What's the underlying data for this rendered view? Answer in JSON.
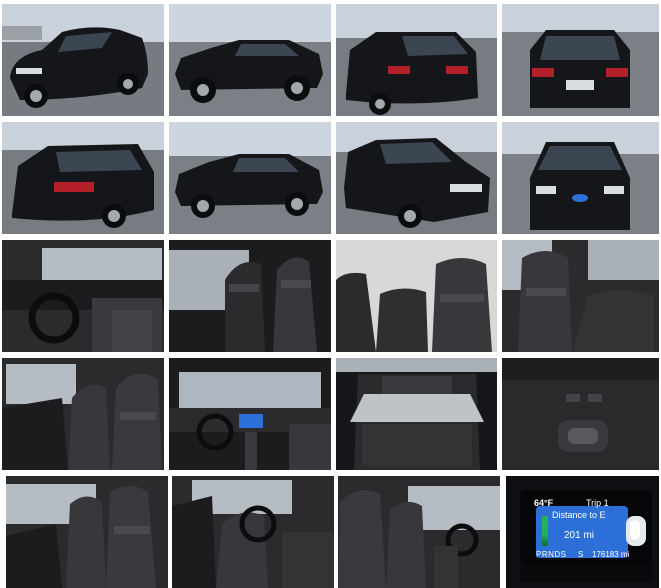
{
  "gallery": {
    "photos": [
      {
        "subject": "exterior-front-left"
      },
      {
        "subject": "exterior-left-side"
      },
      {
        "subject": "exterior-rear-left"
      },
      {
        "subject": "exterior-rear"
      },
      {
        "subject": "exterior-rear-left-closeup"
      },
      {
        "subject": "exterior-side-profile"
      },
      {
        "subject": "exterior-front-right"
      },
      {
        "subject": "exterior-front"
      },
      {
        "subject": "interior-driver-dashboard"
      },
      {
        "subject": "interior-front-seats"
      },
      {
        "subject": "interior-rear-seats"
      },
      {
        "subject": "interior-rear-seats-angle"
      },
      {
        "subject": "interior-rear-seat-door"
      },
      {
        "subject": "interior-dashboard-view"
      },
      {
        "subject": "cargo-area"
      },
      {
        "subject": "trunk-release-button"
      },
      {
        "subject": "interior-rear-cabin"
      },
      {
        "subject": "interior-driver-door-open"
      },
      {
        "subject": "interior-passenger-side"
      },
      {
        "subject": "instrument-cluster"
      }
    ],
    "cluster": {
      "temperature": "64°F",
      "trip": "Trip 1",
      "distance_label": "Distance to E",
      "distance_value": "201 mi",
      "odometer": "176183 mi",
      "gear": "PRNDS",
      "gear_mode": "S"
    },
    "colors": {
      "car_body": "#141619",
      "asphalt": "#767b82",
      "sky": "#c9d1da",
      "leather": "#2b2b2e",
      "screen_blue": "#2d6fd8"
    }
  }
}
